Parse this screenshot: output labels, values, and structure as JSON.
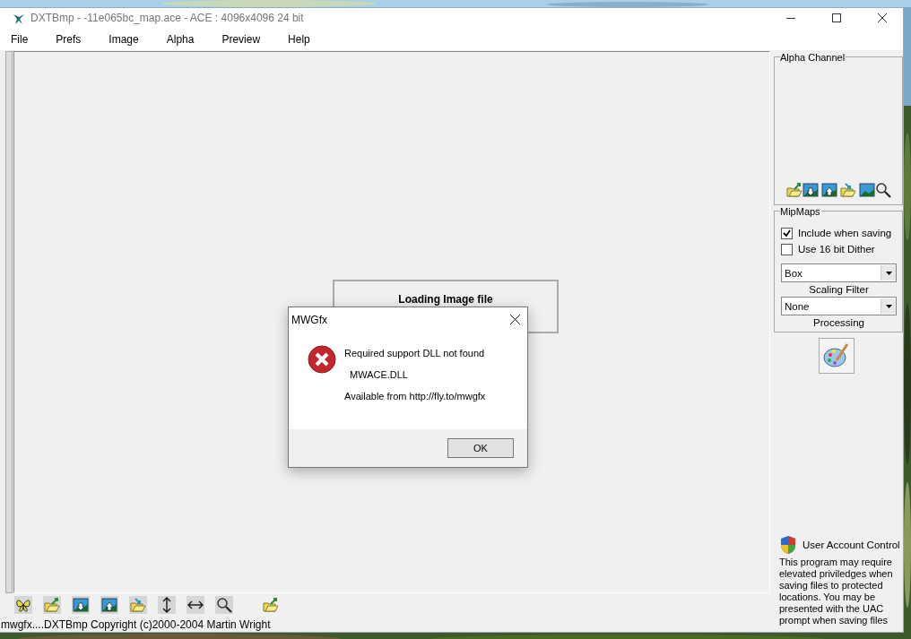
{
  "window": {
    "title": "DXTBmp - -11e065bc_map.ace - ACE : 4096x4096 24 bit"
  },
  "menu": [
    "File",
    "Prefs",
    "Image",
    "Alpha",
    "Preview",
    "Help"
  ],
  "loading": {
    "text": "Loading Image file"
  },
  "alpha_channel": {
    "title": "Alpha Channel"
  },
  "mipmaps": {
    "title": "MipMaps",
    "options": [
      {
        "label": "Include when saving",
        "checked": true
      },
      {
        "label": "Use 16 bit Dither",
        "checked": false
      }
    ],
    "scaling_filter": {
      "value": "Box",
      "label": "Scaling Filter"
    },
    "processing": {
      "value": "None",
      "label": "Processing"
    }
  },
  "uac": {
    "title": "User Account Control",
    "text": "This program may require elevated priviledges when saving files to protected locations. You may be presented with the UAC prompt when saving files"
  },
  "status_bar": "mwgfx....DXTBmp Copyright (c)2000-2004 Martin Wright",
  "dialog": {
    "title": "MWGfx",
    "message": "Required support DLL not found",
    "dll": "MWACE.DLL",
    "source": "Available from http://fly.to/mwgfx",
    "button": "OK"
  }
}
